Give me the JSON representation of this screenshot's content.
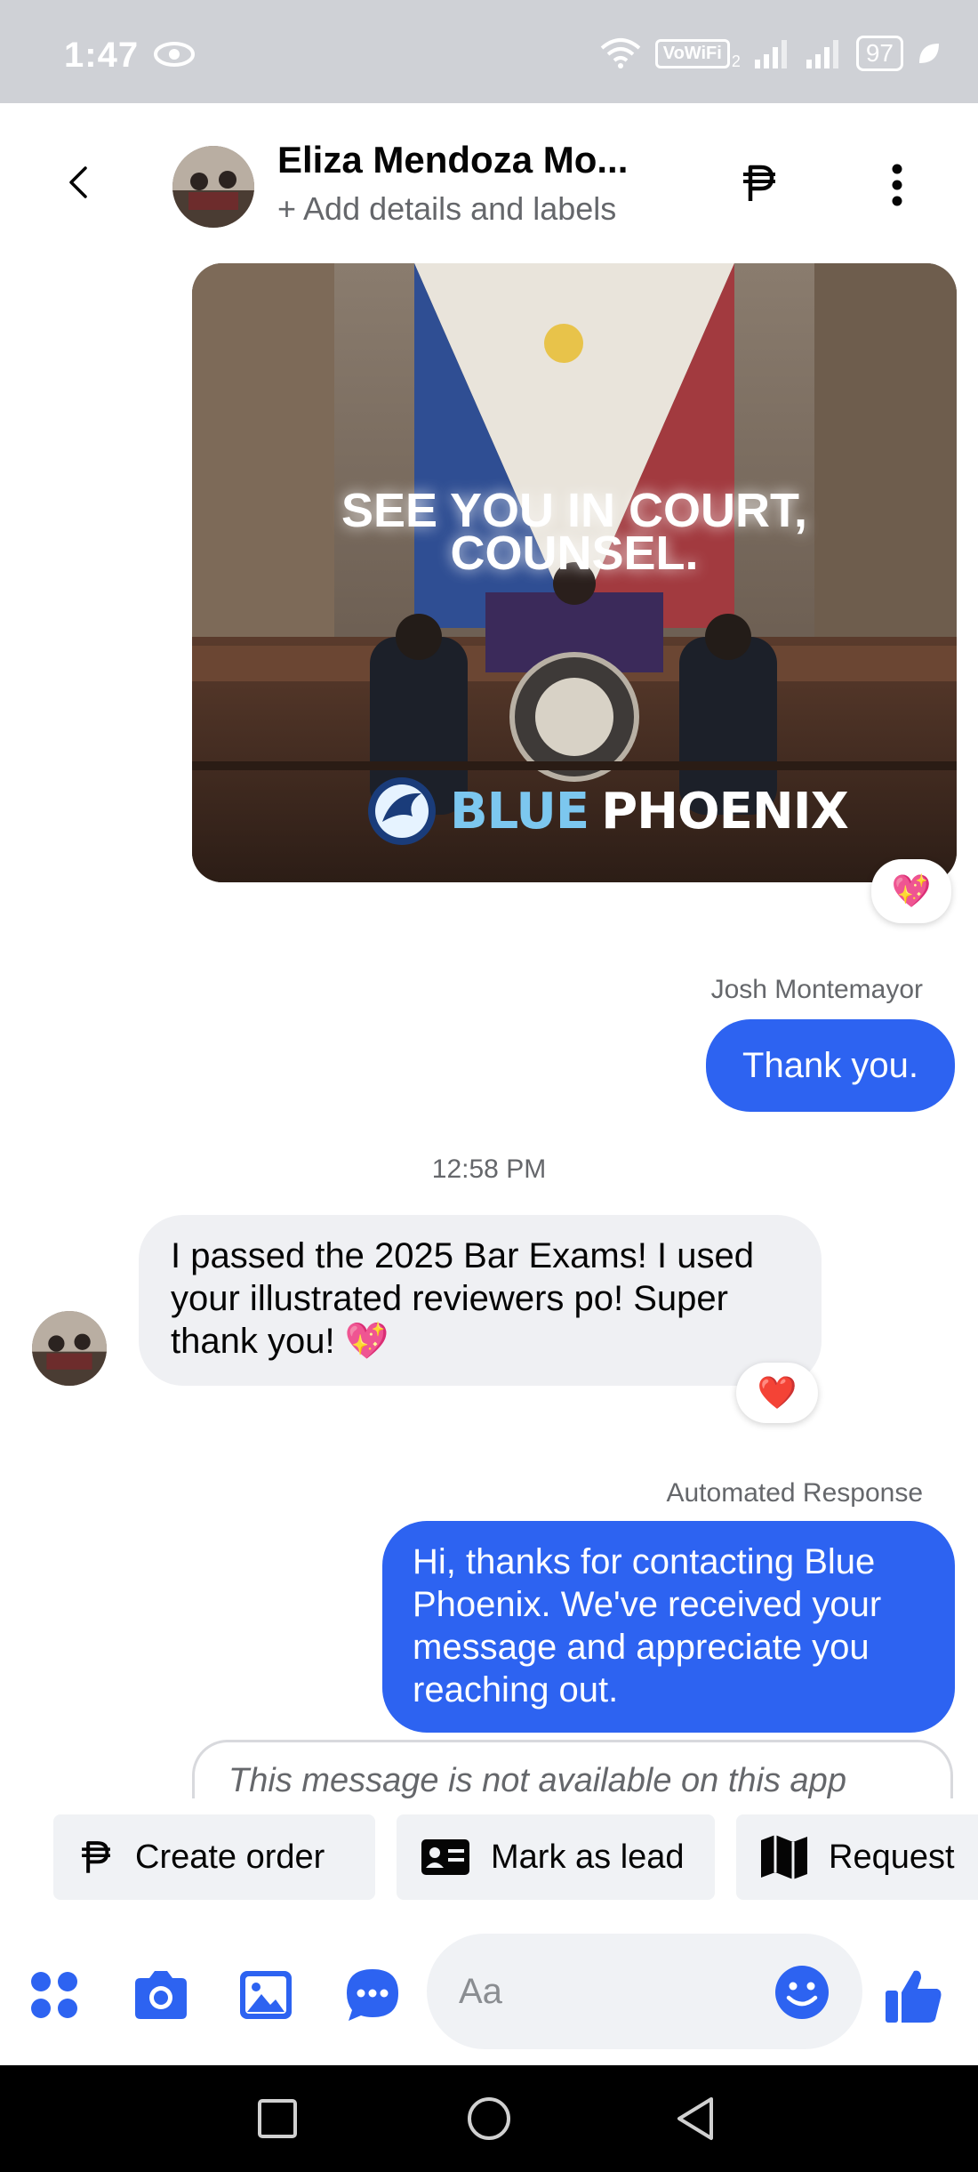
{
  "status_bar": {
    "time": "1:47",
    "vowifi": "VoWiFi",
    "vowifi_sub": "2",
    "battery": "97"
  },
  "header": {
    "contact_name": "Eliza Mendoza Mo...",
    "subtitle": "+ Add details and labels"
  },
  "post_image": {
    "headline_line1": "SEE YOU IN COURT,",
    "headline_line2": "COUNSEL.",
    "brand_part1": "BLUE",
    "brand_part2": "PHOENIX",
    "reaction": "💖"
  },
  "messages": [
    {
      "sender_label": "Josh Montemayor",
      "text": "Thank you."
    },
    {
      "timestamp": "12:58 PM"
    },
    {
      "text": "I passed the 2025 Bar Exams! I used your illustrated reviewers po! Super thank you! 💖",
      "reaction": "❤️"
    },
    {
      "sender_label": "Automated Response",
      "text": "Hi, thanks for contacting Blue Phoenix. We've received your message and appreciate you reaching out."
    },
    {
      "text": "This message is not available on this app"
    }
  ],
  "quick_actions": [
    {
      "label": "Create order",
      "icon": "peso-icon"
    },
    {
      "label": "Mark as lead",
      "icon": "contact-card-icon"
    },
    {
      "label": "Request",
      "icon": "map-icon"
    }
  ],
  "composer": {
    "placeholder": "Aa"
  },
  "colors": {
    "accent": "#2d63f1",
    "incoming_bubble": "#eff0f3",
    "status_bar": "#cfd1d6"
  }
}
